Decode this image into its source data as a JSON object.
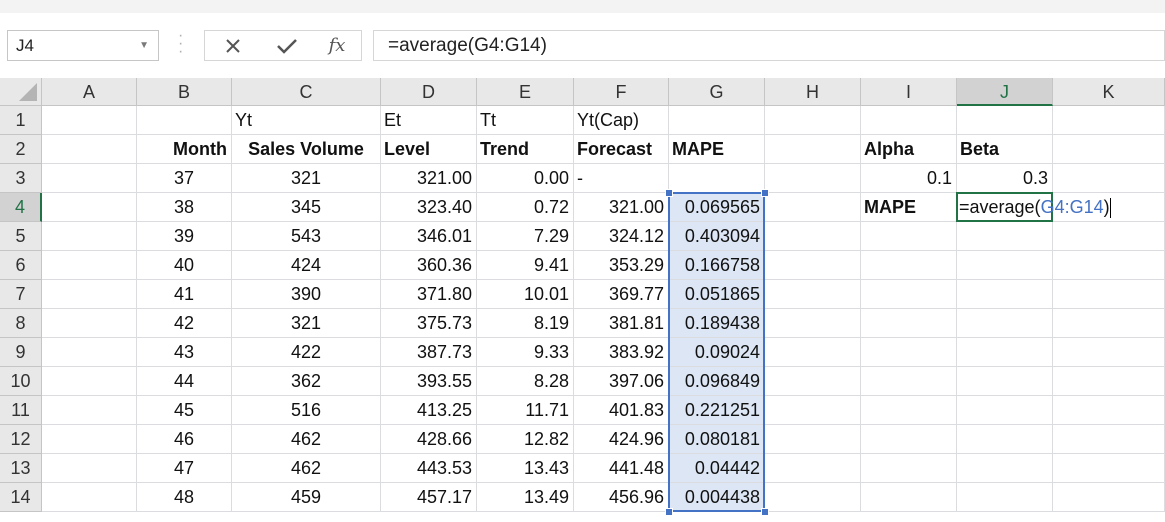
{
  "name_box": "J4",
  "formula_bar": {
    "cancel_icon": "×",
    "enter_icon": "✓",
    "fx_label": "fx",
    "formula": "=average(G4:G14)"
  },
  "columns": [
    "A",
    "B",
    "C",
    "D",
    "E",
    "F",
    "G",
    "H",
    "I",
    "J",
    "K"
  ],
  "active_column": "J",
  "active_row": "4",
  "rows": [
    {
      "n": "1",
      "B": "",
      "C": "Yt",
      "D": "Et",
      "E": "Tt",
      "F": "Yt(Cap)",
      "G": "",
      "I": "",
      "J": ""
    },
    {
      "n": "2",
      "B": "Month",
      "C": "Sales Volume",
      "D": "Level",
      "E": "Trend",
      "F": "Forecast",
      "G": "MAPE",
      "I": "Alpha",
      "J": "Beta"
    },
    {
      "n": "3",
      "B": "37",
      "C": "321",
      "D": "321.00",
      "E": "0.00",
      "F": "-",
      "G": "",
      "I": "0.1",
      "J": "0.3"
    },
    {
      "n": "4",
      "B": "38",
      "C": "345",
      "D": "323.40",
      "E": "0.72",
      "F": "321.00",
      "G": "0.069565",
      "I": "MAPE",
      "J": ""
    },
    {
      "n": "5",
      "B": "39",
      "C": "543",
      "D": "346.01",
      "E": "7.29",
      "F": "324.12",
      "G": "0.403094",
      "I": "",
      "J": ""
    },
    {
      "n": "6",
      "B": "40",
      "C": "424",
      "D": "360.36",
      "E": "9.41",
      "F": "353.29",
      "G": "0.166758",
      "I": "",
      "J": ""
    },
    {
      "n": "7",
      "B": "41",
      "C": "390",
      "D": "371.80",
      "E": "10.01",
      "F": "369.77",
      "G": "0.051865",
      "I": "",
      "J": ""
    },
    {
      "n": "8",
      "B": "42",
      "C": "321",
      "D": "375.73",
      "E": "8.19",
      "F": "381.81",
      "G": "0.189438",
      "I": "",
      "J": ""
    },
    {
      "n": "9",
      "B": "43",
      "C": "422",
      "D": "387.73",
      "E": "9.33",
      "F": "383.92",
      "G": "0.09024",
      "I": "",
      "J": ""
    },
    {
      "n": "10",
      "B": "44",
      "C": "362",
      "D": "393.55",
      "E": "8.28",
      "F": "397.06",
      "G": "0.096849",
      "I": "",
      "J": ""
    },
    {
      "n": "11",
      "B": "45",
      "C": "516",
      "D": "413.25",
      "E": "11.71",
      "F": "401.83",
      "G": "0.221251",
      "I": "",
      "J": ""
    },
    {
      "n": "12",
      "B": "46",
      "C": "462",
      "D": "428.66",
      "E": "12.82",
      "F": "424.96",
      "G": "0.080181",
      "I": "",
      "J": ""
    },
    {
      "n": "13",
      "B": "47",
      "C": "462",
      "D": "443.53",
      "E": "13.43",
      "F": "441.48",
      "G": "0.04442",
      "I": "",
      "J": ""
    },
    {
      "n": "14",
      "B": "48",
      "C": "459",
      "D": "457.17",
      "E": "13.49",
      "F": "456.96",
      "G": "0.004438",
      "I": "",
      "J": ""
    }
  ],
  "editing_cell": {
    "prefix": "=average(",
    "ref": "G4:G14",
    "suffix": ")"
  },
  "colors": {
    "accent": "#217346",
    "range": "#4472c4",
    "shade": "#dce6f4"
  }
}
